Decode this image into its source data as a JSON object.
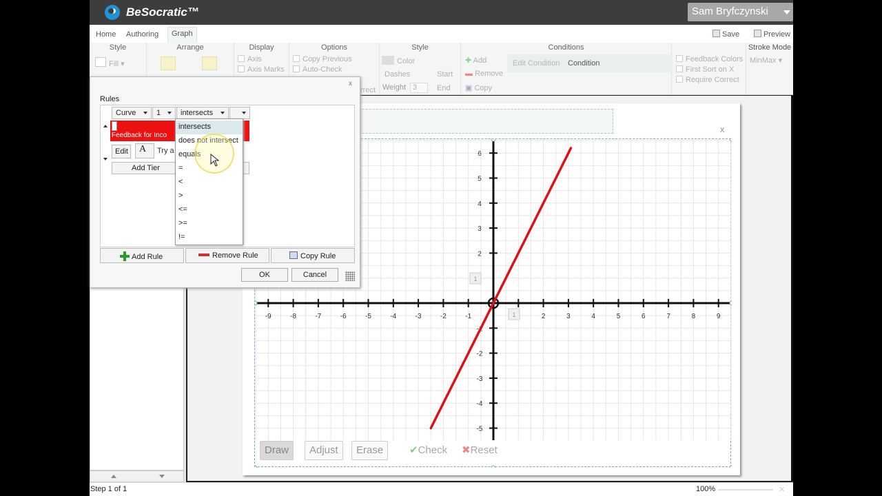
{
  "app": {
    "title": "BeSocratic™",
    "user": "Sam Bryfczynski"
  },
  "tabs": [
    {
      "label": "Home"
    },
    {
      "label": "Authoring"
    },
    {
      "label": "Graph"
    }
  ],
  "toolbar": {
    "save_label": "Save",
    "preview_label": "Preview"
  },
  "ribbon": {
    "style": {
      "title": "Style",
      "fill": "Fill"
    },
    "arrange": {
      "title": "Arrange"
    },
    "display": {
      "title": "Display",
      "axis": "Axis",
      "axis_marks": "Axis Marks"
    },
    "options": {
      "title": "Options",
      "copy_previous": "Copy Previous",
      "auto_check": "Auto-Check",
      "correct_fragment": "rrect"
    },
    "style2": {
      "title": "Style",
      "color": "Color",
      "dashes": "Dashes",
      "start": "Start",
      "weight": "Weight",
      "weight_value": "3",
      "end": "End"
    },
    "conditions": {
      "title": "Conditions",
      "add": "Add",
      "remove": "Remove",
      "copy": "Copy",
      "edit_condition": "Edit Condition",
      "condition": "Condition"
    },
    "feedback": {
      "feedback_colors": "Feedback Colors",
      "first_sort": "First Sort on X",
      "require_correct": "Require Correct"
    },
    "stroke": {
      "title": "Stroke Mode",
      "value": "MinMax"
    }
  },
  "rules_dialog": {
    "close": "x",
    "label": "Rules",
    "curve_combo": "Curve",
    "index_combo": "1",
    "operator_combo": "intersects",
    "feedback_text": "Feedback for Inco",
    "edit_label": "Edit",
    "font_label": "A",
    "try_text": "Try a",
    "add_tier": "Add Tier",
    "add_rule": "Add Rule",
    "remove_rule": "Remove Rule",
    "copy_rule": "Copy Rule",
    "ok": "OK",
    "cancel": "Cancel",
    "operators": [
      "intersects",
      "does not intersect",
      "equals",
      "=",
      "<",
      ">",
      "<=",
      ">=",
      "!="
    ],
    "selected_operator": "intersects"
  },
  "graph": {
    "close": "x",
    "x_ticks": [
      "-9",
      "-8",
      "-7",
      "-6",
      "-5",
      "-4",
      "-3",
      "-2",
      "-1",
      "1",
      "2",
      "3",
      "4",
      "5",
      "6",
      "7",
      "8",
      "9"
    ],
    "y_ticks": [
      "6",
      "5",
      "4",
      "3",
      "2",
      "-1",
      "-2",
      "-3",
      "-4",
      "-5"
    ],
    "marker_x": "1",
    "marker_y": "1",
    "curve_color": "#dd1111",
    "tools": {
      "draw": "Draw",
      "adjust": "Adjust",
      "erase": "Erase",
      "check": "Check",
      "reset": "Reset"
    }
  },
  "status": {
    "step": "Step 1 of 1",
    "zoom": "100%"
  }
}
